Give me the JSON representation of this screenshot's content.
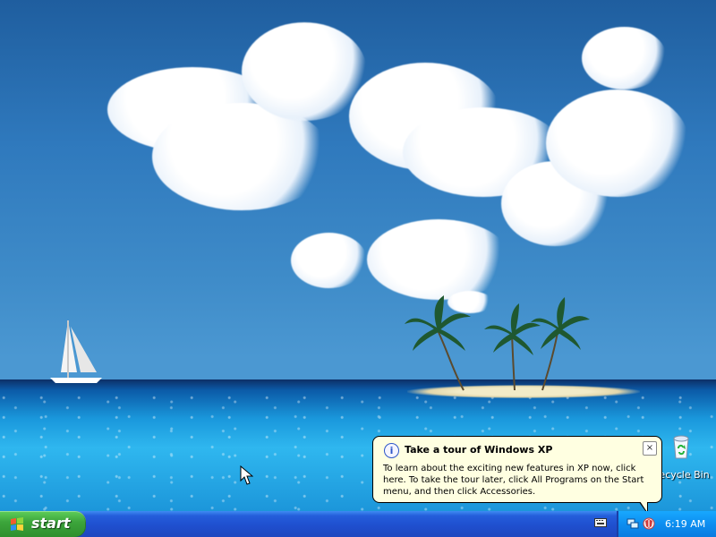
{
  "desktop": {
    "icons": [
      {
        "label": "Recycle Bin",
        "icon": "recycle-bin-icon"
      }
    ]
  },
  "balloon": {
    "icon": "info-icon",
    "title": "Take a tour of Windows XP",
    "body": "To learn about the exciting new features in XP now, click here. To take the tour later, click All Programs on the Start menu, and then click Accessories.",
    "close": "×"
  },
  "taskbar": {
    "start_label": "start",
    "clock": "6:19 AM",
    "tray_icons": [
      "language-bar-icon",
      "network-icon",
      "security-shield-icon"
    ]
  },
  "colors": {
    "taskbar": "#245edb",
    "start_button": "#3ca53b",
    "tray": "#0d8ef0",
    "balloon": "#ffffe1"
  }
}
